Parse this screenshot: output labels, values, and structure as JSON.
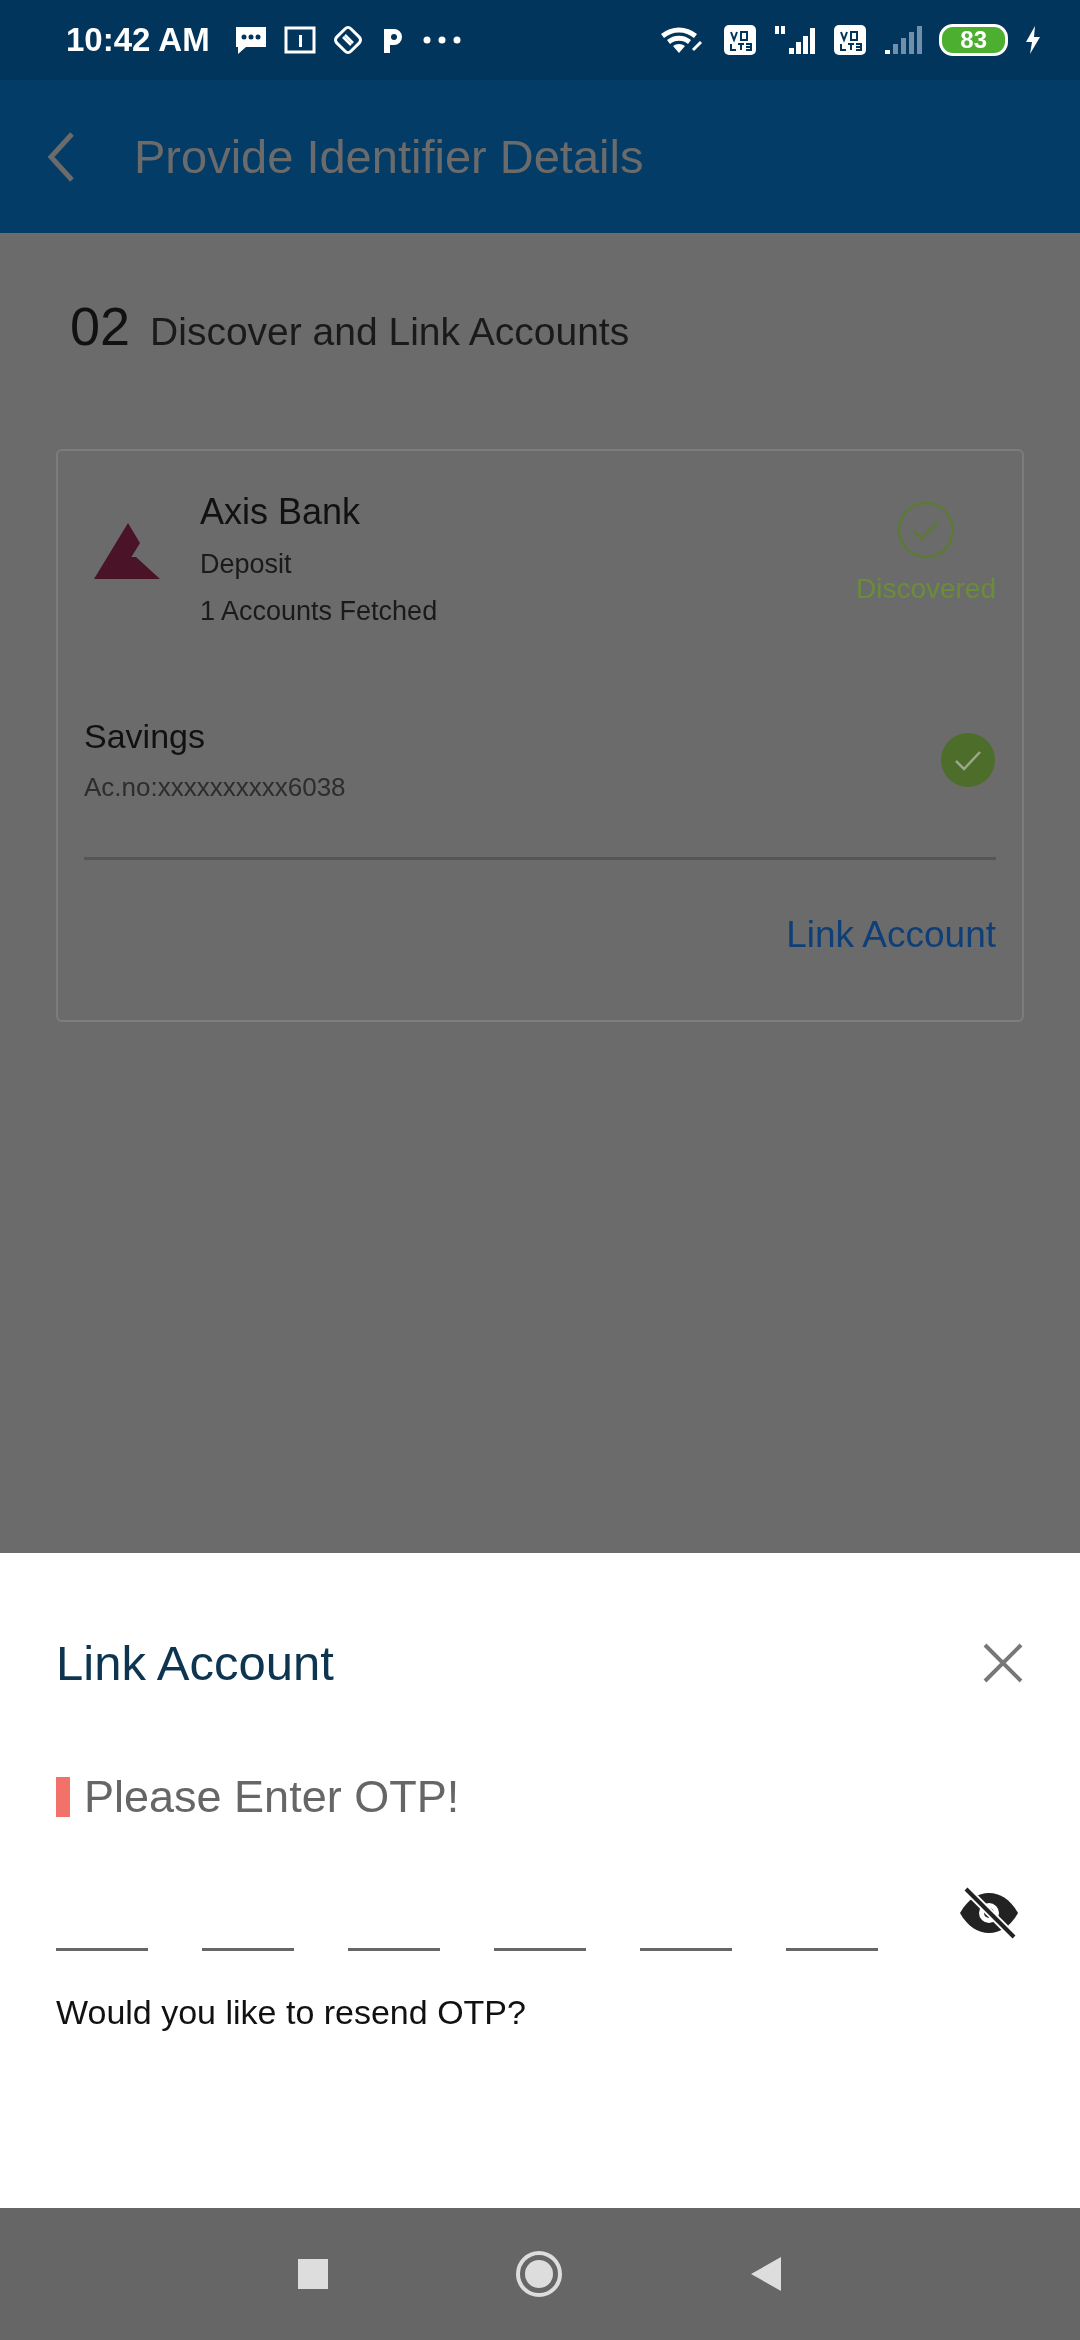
{
  "status_bar": {
    "time": "10:42 AM",
    "battery": "83",
    "charging": true
  },
  "app_bar": {
    "title": "Provide Identifier Details"
  },
  "step": {
    "number": "02",
    "title": "Discover and Link Accounts"
  },
  "bank_card": {
    "bank": "Axis Bank",
    "type": "Deposit",
    "fetched": "1 Accounts Fetched",
    "status": "Discovered",
    "accounts": [
      {
        "name": "Savings",
        "number": "Ac.no:xxxxxxxxxx6038",
        "selected": true
      }
    ],
    "action": "Link Account"
  },
  "sheet": {
    "title": "Link Account",
    "prompt": "Please Enter OTP!",
    "required_mark": true,
    "fields": [
      {
        "filled": false
      },
      {
        "filled": false
      },
      {
        "filled": false
      },
      {
        "filled": false
      },
      {
        "filled": false
      },
      {
        "filled": false
      }
    ],
    "hidden": true,
    "resend": "Would you like to resend OTP?"
  }
}
